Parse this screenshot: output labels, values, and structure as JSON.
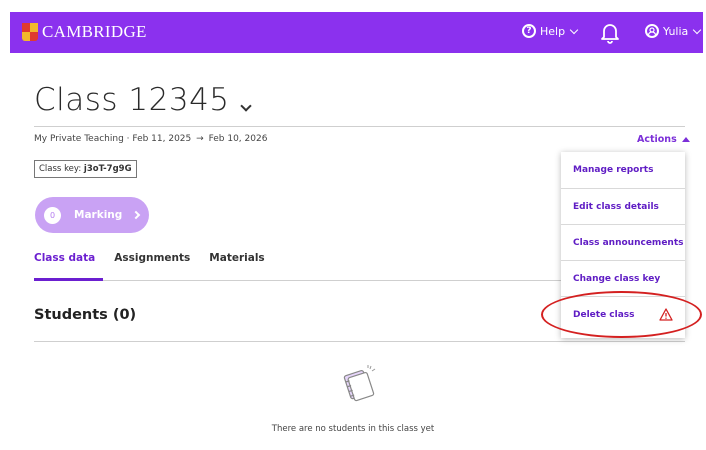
{
  "header": {
    "brand": "CAMBRIDGE",
    "help_label": "Help",
    "user_label": "Yulia",
    "help_glyph": "?"
  },
  "page": {
    "title": "Class 12345",
    "subtitle_org": "My Private Teaching",
    "subtitle_start": "Feb 11, 2025",
    "subtitle_arrow": "→",
    "subtitle_end": "Feb 10, 2026",
    "actions_label": "Actions",
    "class_key_label": "Class key:",
    "class_key_value": "j3oT-7g9G"
  },
  "marking": {
    "count": "0",
    "label": "Marking"
  },
  "tabs": [
    {
      "label": "Class data",
      "active": true
    },
    {
      "label": "Assignments",
      "active": false
    },
    {
      "label": "Materials",
      "active": false
    }
  ],
  "students": {
    "heading": "Students (0)",
    "empty_message": "There are no students in this class yet"
  },
  "actions_menu": {
    "items": [
      {
        "label": "Manage reports"
      },
      {
        "label": "Edit class details"
      },
      {
        "label": "Class announcements"
      },
      {
        "label": "Change class key"
      },
      {
        "label": "Delete class",
        "icon": "warning-icon"
      }
    ]
  },
  "colors": {
    "brand_purple": "#8b31ee",
    "link_purple": "#6b1fd0",
    "marking_bg": "#c9a2f4",
    "highlight_red": "#d42020"
  }
}
